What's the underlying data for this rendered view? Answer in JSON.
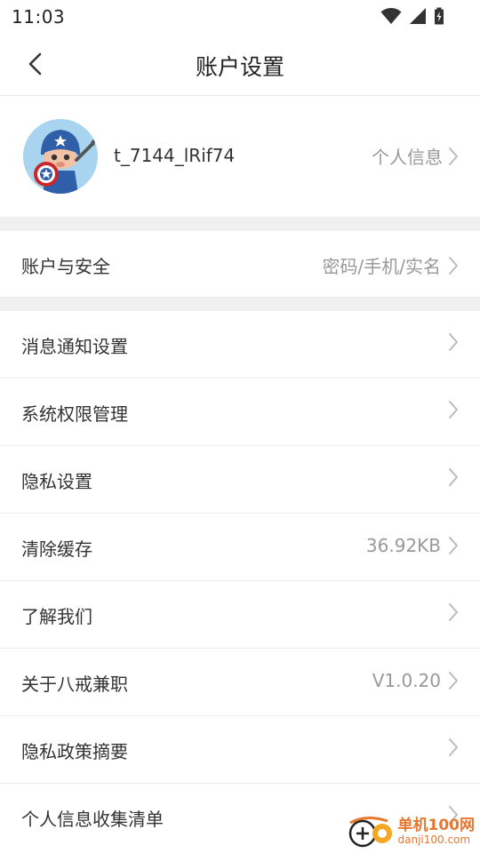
{
  "status_bar": {
    "time": "11:03",
    "icons": [
      "wifi-icon",
      "signal-icon",
      "battery-charging-icon"
    ]
  },
  "header": {
    "title": "账户设置",
    "back_icon": "chevron-left-icon"
  },
  "profile": {
    "username": "t_7144_lRif74",
    "link_label": "个人信息",
    "avatar_icon": "captain-cartoon-avatar"
  },
  "rows": [
    {
      "label": "账户与安全",
      "value": "密码/手机/实名"
    },
    {
      "label": "消息通知设置",
      "value": ""
    },
    {
      "label": "系统权限管理",
      "value": ""
    },
    {
      "label": "隐私设置",
      "value": ""
    },
    {
      "label": "清除缓存",
      "value": "36.92KB"
    },
    {
      "label": "了解我们",
      "value": ""
    },
    {
      "label": "关于八戒兼职",
      "value": "V1.0.20"
    },
    {
      "label": "隐私政策摘要",
      "value": ""
    },
    {
      "label": "个人信息收集清单",
      "value": ""
    }
  ],
  "watermark": {
    "name": "单机100网",
    "domain": "danji100.com"
  },
  "colors": {
    "background": "#ffffff",
    "section_gap": "#f0f0f0",
    "primary_text": "#333333",
    "secondary_text": "#999999",
    "chevron": "#bbbbbb",
    "watermark": "#e8772e"
  }
}
